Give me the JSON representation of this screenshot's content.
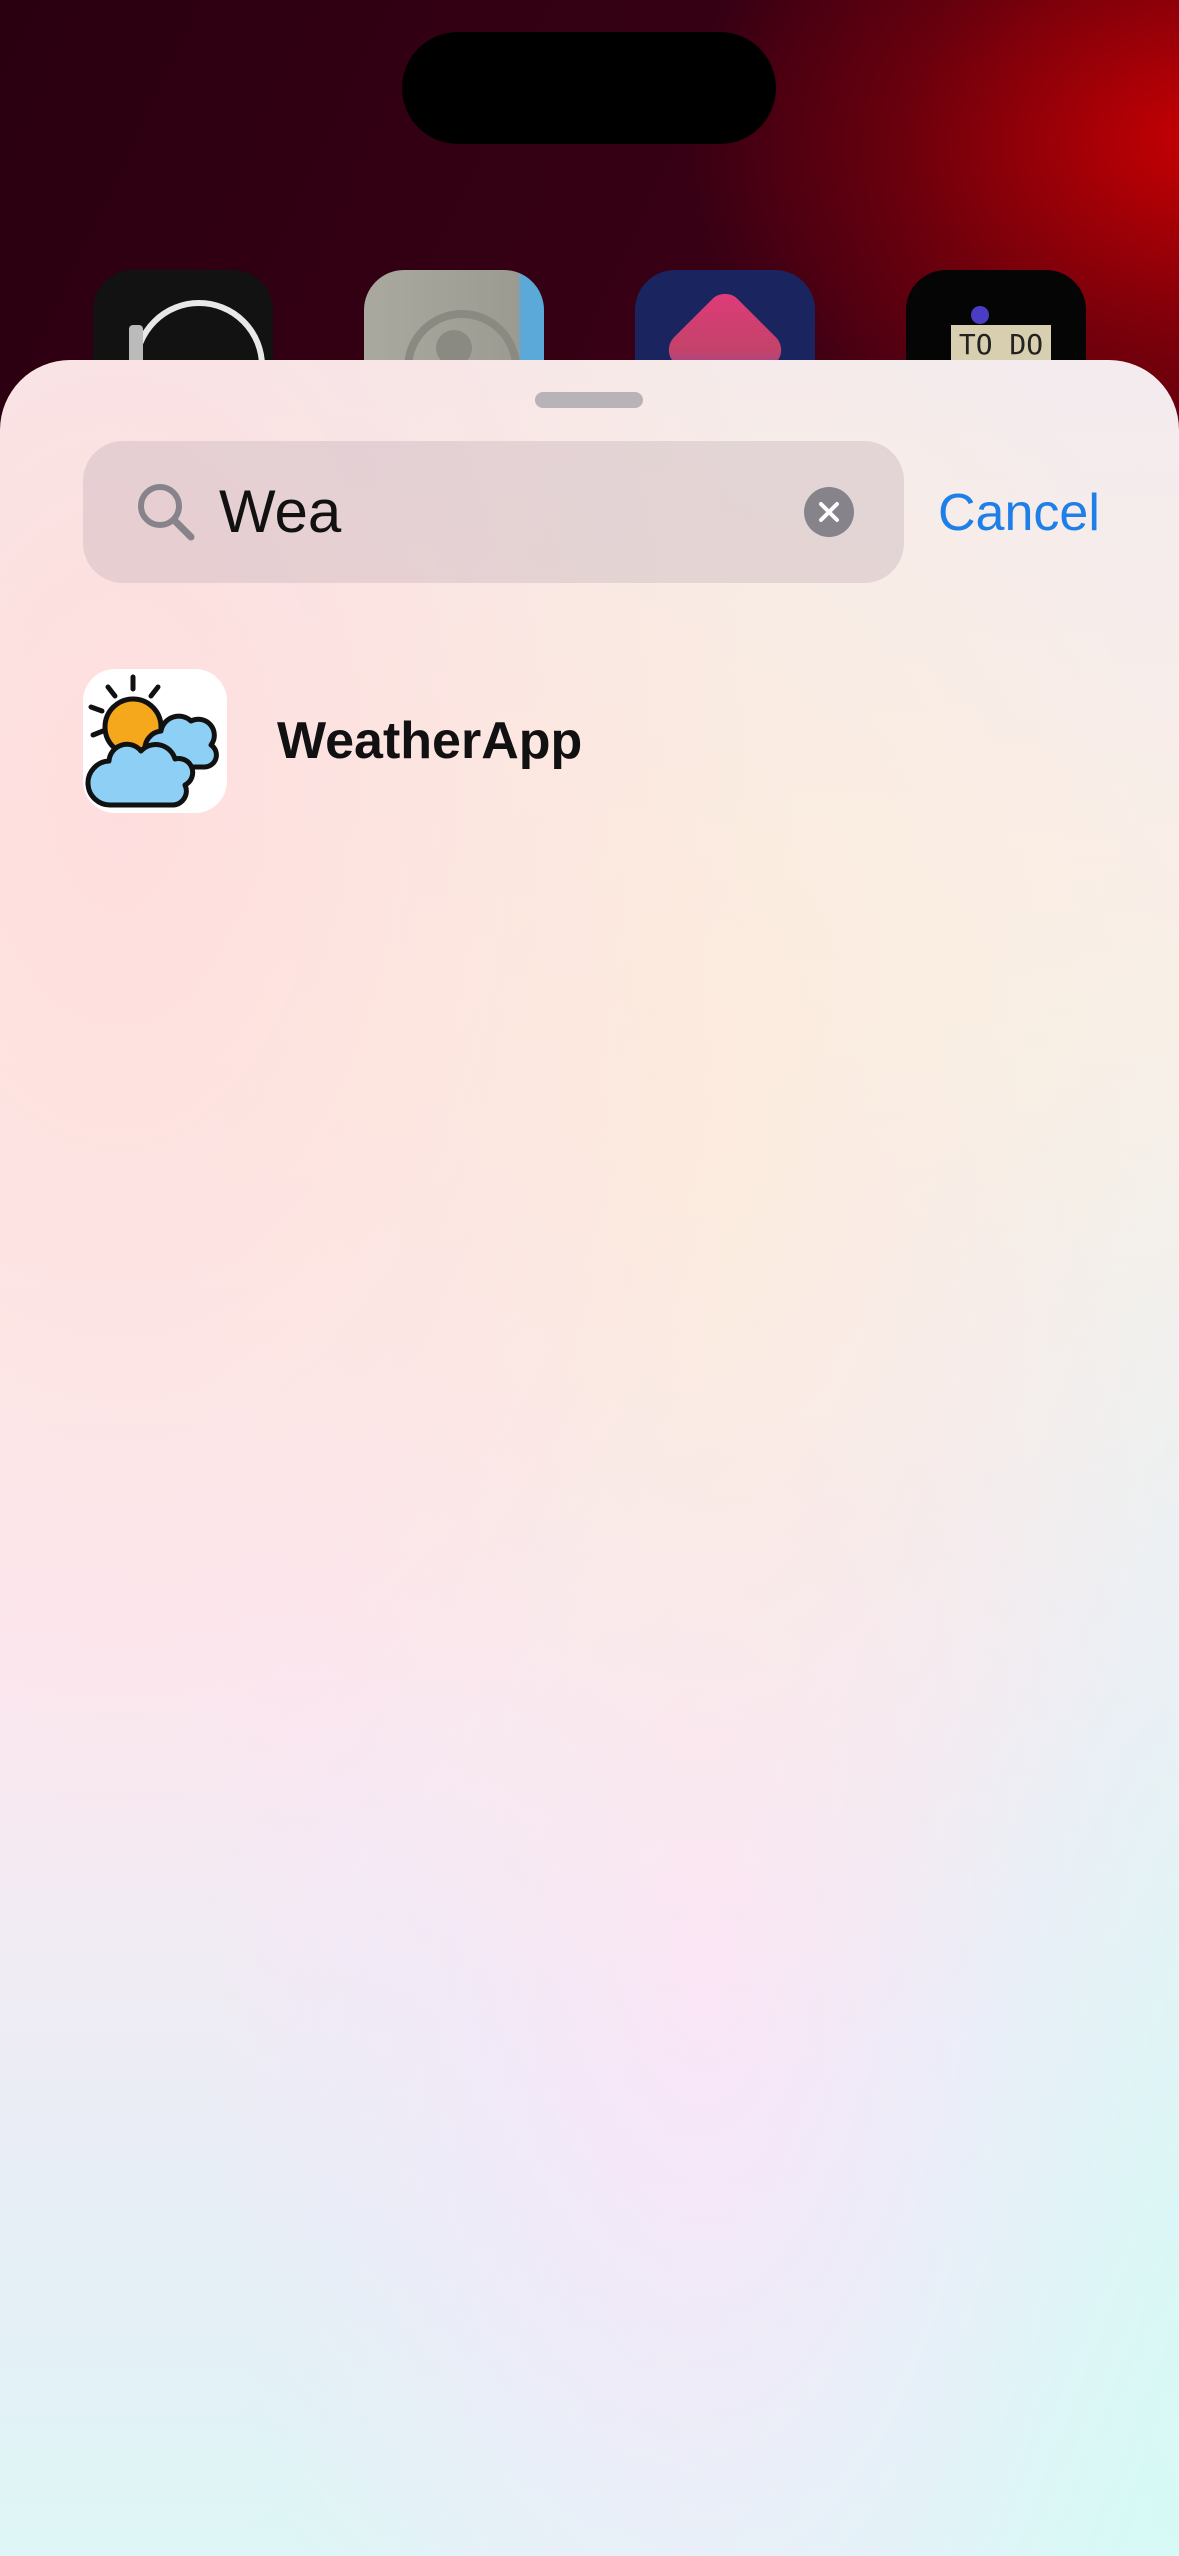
{
  "home_screen": {
    "icons": [
      "watch-icon",
      "contacts-icon",
      "shortcuts-icon",
      "todo-icon"
    ],
    "todo_icon_text": "TO DO"
  },
  "search": {
    "value": "Wea",
    "icon": "search-icon",
    "clear_icon": "clear-icon"
  },
  "cancel_label": "Cancel",
  "results": [
    {
      "name": "WeatherApp",
      "icon": "weather-app-icon"
    }
  ],
  "colors": {
    "accent": "#1f7fe8",
    "sun": "#f6a81c",
    "cloud": "#8ed0f5"
  }
}
